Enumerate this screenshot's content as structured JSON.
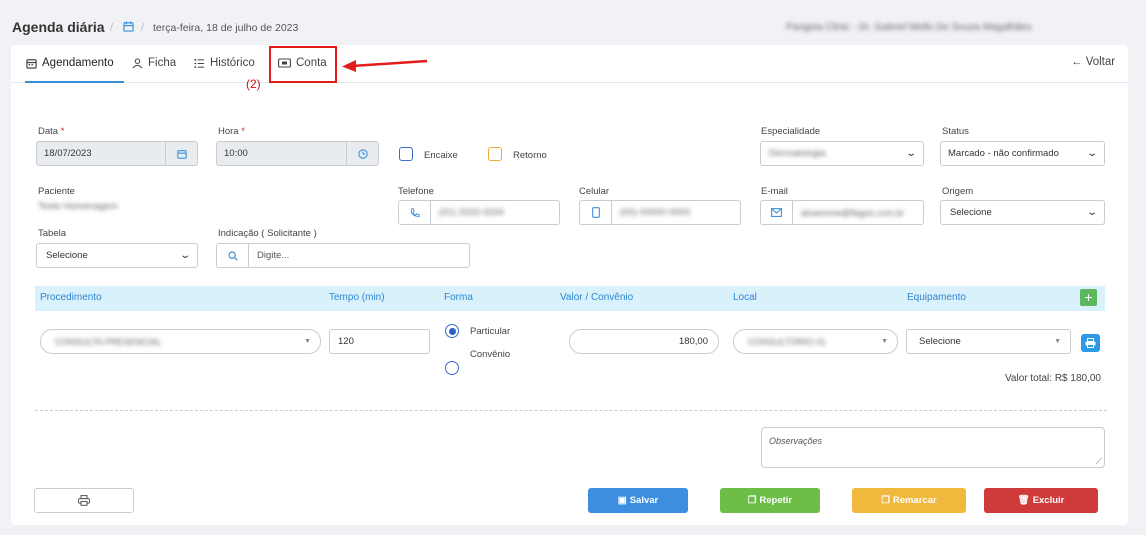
{
  "header": {
    "title": "Agenda diária",
    "separator": "/",
    "date": "terça-feira, 18 de julho de 2023",
    "clinic_info": "Pangeia Clinic - Dr. Gabriel Mello De Souza Magalhães"
  },
  "tabs": [
    {
      "label": "Agendamento",
      "icon": "calendar-icon"
    },
    {
      "label": "Ficha",
      "icon": "user-icon"
    },
    {
      "label": "Histórico",
      "icon": "list-icon"
    },
    {
      "label": "Conta",
      "icon": "wallet-icon"
    }
  ],
  "back_label": "← Voltar",
  "annotation": {
    "number": "(2)",
    "color": "#e21b1b"
  },
  "form": {
    "data_label": "Data",
    "data_value": "18/07/2023",
    "hora_label": "Hora",
    "hora_value": "10:00",
    "required_mark": "*",
    "encaixe_label": "Encaixe",
    "retorno_label": "Retorno",
    "especialidade_label": "Especialidade",
    "especialidade_value": "Dermatologia",
    "status_label": "Status",
    "status_value": "Marcado - não confirmado",
    "paciente_label": "Paciente",
    "paciente_value": "Teste Homenagem",
    "telefone_label": "Telefone",
    "telefone_value": "(41) 3333-3334",
    "celular_label": "Celular",
    "celular_value": "(00) 00000-0000",
    "email_label": "E-mail",
    "email_value": "atoanome@flagos.com.br",
    "origem_label": "Origem",
    "origem_value": "Selecione",
    "tabela_label": "Tabela",
    "tabela_value": "Selecione",
    "indicacao_label": "Indicação ( Solicitante )",
    "indicacao_placeholder": "Digite..."
  },
  "procedures": {
    "headers": [
      "Procedimento",
      "Tempo (min)",
      "Forma",
      "Valor / Convênio",
      "Local",
      "Equipamento"
    ],
    "row": {
      "procedimento": "CONSULTA PRESENCIAL",
      "tempo": "120",
      "forma_options": [
        "Particular",
        "Convênio"
      ],
      "forma_selected": "Particular",
      "valor": "180,00",
      "local": "CONSULTÓRIO 01",
      "equipamento": "Selecione"
    },
    "total": "Valor total: R$ 180,00"
  },
  "observacoes_placeholder": "Observações",
  "buttons": {
    "salvar": "Salvar",
    "repetir": "Repetir",
    "remarcar": "Remarcar",
    "excluir": "Excluir"
  },
  "colors": {
    "accent": "#3b8ed8",
    "salvar": "#3c8ee0",
    "repetir": "#6cbe46",
    "remarcar": "#f0b83c",
    "excluir": "#cf3b3b",
    "encaixe_border": "#3d6dcc",
    "retorno_border": "#f0a830"
  }
}
